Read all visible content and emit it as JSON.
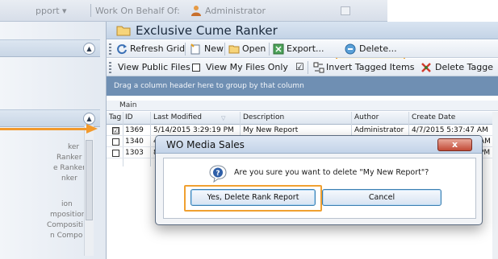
{
  "topbar": {
    "support_label": "pport ▾",
    "work_on_behalf_label": "Work On Behalf Of:",
    "user_name": "Administrator"
  },
  "window": {
    "title": "Exclusive Cume Ranker"
  },
  "toolbar1": {
    "refresh_label": "Refresh Grid",
    "new_label": "New",
    "open_label": "Open",
    "export_label": "Export...",
    "delete_label": "Delete..."
  },
  "toolbar2": {
    "view_public_label": "View Public Files",
    "view_my_label": "View My Files Only",
    "view_my_checked": "☑",
    "invert_label": "Invert Tagged Items",
    "delete_tagged_label": "Delete Tagge"
  },
  "group_panel": {
    "text": "Drag a column header here to group by that column"
  },
  "band": {
    "label": "Main"
  },
  "grid": {
    "columns": [
      "Tag",
      "ID",
      "Last Modified",
      "Description",
      "Author",
      "Create Date"
    ],
    "rows": [
      {
        "tag": "☑",
        "id": "1369",
        "last_modified": "5/14/2015 3:29:19 PM",
        "description": "My New Report",
        "author": "Administrator",
        "create_date": "4/7/2015 5:37:47 AM"
      },
      {
        "tag": "",
        "id": "1340",
        "last_modified": "4/",
        "description": "",
        "author": "",
        "create_date": "AM"
      },
      {
        "tag": "",
        "id": "1303",
        "last_modified": "8/",
        "description": "",
        "author": "",
        "create_date": "PM"
      }
    ]
  },
  "sidebar": {
    "items": [
      "ker",
      "Ranker",
      "e Ranker",
      "nker",
      "ion",
      "mposition",
      "Compositi",
      "n Compo"
    ]
  },
  "dialog": {
    "title": "WO Media Sales",
    "close": "x",
    "message": "Are you sure you want to delete \"My New Report\"?",
    "yes_label": "Yes, Delete Rank Report",
    "cancel_label": "Cancel"
  },
  "colors": {
    "highlight": "#f0a030",
    "arrow": "#f29a2e",
    "group_panel": "#6f8fb3"
  }
}
